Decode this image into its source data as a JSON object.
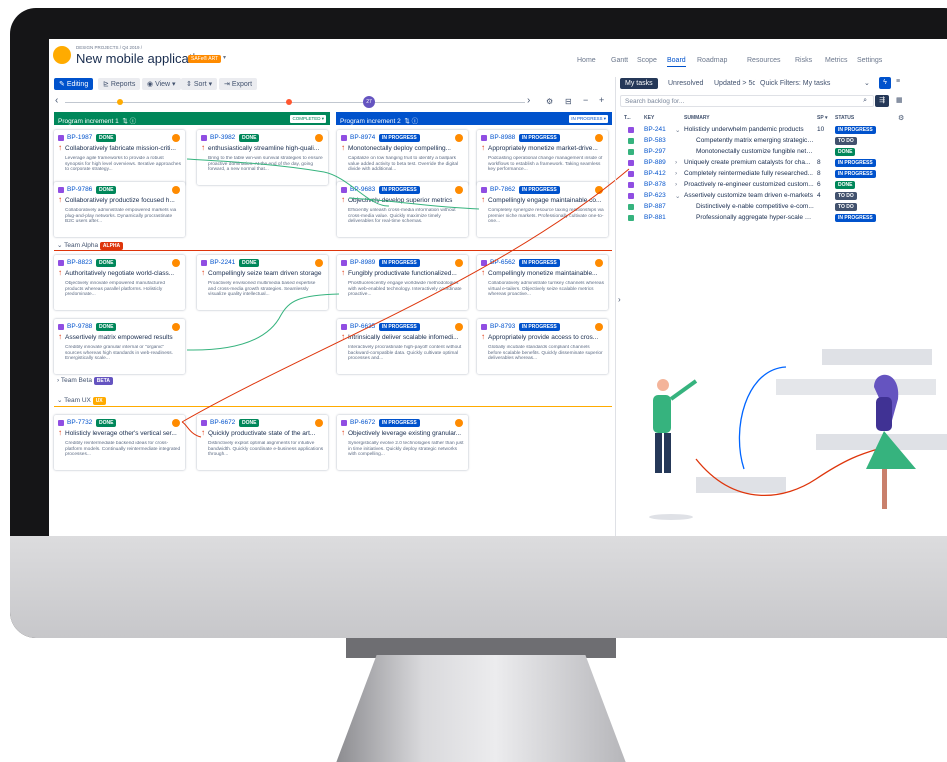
{
  "project": {
    "breadcrumb": "DESIGN PROJECTS / Q4 2019 /",
    "title": "New mobile application",
    "badge": "SAFe® ART"
  },
  "nav": [
    "Home",
    "Gantt",
    "Scope",
    "Board",
    "Roadmap",
    "Resources",
    "Risks",
    "Metrics",
    "Settings"
  ],
  "toolbar": {
    "editing": "Editing",
    "reports": "Reports",
    "view": "View",
    "sort": "Sort",
    "export": "Export"
  },
  "timeline": {
    "marker": "27"
  },
  "pi1": {
    "label": "Program increment 1",
    "badge": "COMPLETED"
  },
  "pi2": {
    "label": "Program increment 2",
    "badge": "IN PROGRESS"
  },
  "lanes": {
    "alpha": "Team Alpha",
    "alpha_tag": "ALPHA",
    "beta": "Team Beta",
    "beta_tag": "BETA",
    "ux": "Team UX",
    "ux_tag": "UX"
  },
  "cards": [
    {
      "key": "BP-1987",
      "status": "DONE",
      "title": "Collaboratively fabricate mission-criti...",
      "desc": "Leverage agile frameworks to provide a robust synopsis for high level overviews. Iterative approaches to corporate strategy..."
    },
    {
      "key": "BP-3982",
      "status": "DONE",
      "title": "enthusiastically streamline high-quali...",
      "desc": "Bring to the table win-win survival strategies to ensure proactive domination. At the end of the day, going forward, a new normal that..."
    },
    {
      "key": "BP-8974",
      "status": "IN PROGRESS",
      "title": "Monotonectally deploy compelling...",
      "desc": "Capitalize on low hanging fruit to identify a ballpark value added activity to beta test. Override the digital divide with additional..."
    },
    {
      "key": "BP-8988",
      "status": "IN PROGRESS",
      "title": "Appropriately monetize market-drive...",
      "desc": "Podcasting operational change management inside of workflows to establish a framework. Taking seamless key performance..."
    },
    {
      "key": "BP-9786",
      "status": "DONE",
      "title": "Collaboratively productize focused h...",
      "desc": "Collaboratively administrate empowered markets via plug-and-play networks. Dynamically procrastinate B2C users after..."
    },
    {
      "key": "BP-9683",
      "status": "IN PROGRESS",
      "title": "Objectively develop superior metrics",
      "desc": "Efficiently unleash cross-media information without cross-media value. Quickly maximize timely deliverables for real-time schemas."
    },
    {
      "key": "BP-7862",
      "status": "IN PROGRESS",
      "title": "Compellingly engage maintainable co...",
      "desc": "Completely synergize resource taxing relationships via premier niche markets. Professionally cultivate one-to-one..."
    },
    {
      "key": "BP-8823",
      "status": "DONE",
      "title": "Authoritatively negotiate world-class...",
      "desc": "Objectively innovate empowered manufactured products whereas parallel platforms. Holisticly predominate..."
    },
    {
      "key": "BP-2241",
      "status": "DONE",
      "title": "Compellingly seize team driven storage",
      "desc": "Proactively envisioned multimedia based expertise and cross-media growth strategies. Seamlessly visualize quality intellectual..."
    },
    {
      "key": "BP-8989",
      "status": "IN PROGRESS",
      "title": "Fungibly productivate functionalized...",
      "desc": "Phosfluorescently engage worldwide methodologies with web-enabled technology. Interactively coordinate proactive..."
    },
    {
      "key": "BP-6562",
      "status": "IN PROGRESS",
      "title": "Compellingly monetize maintainable...",
      "desc": "Collaboratively administrate turnkey channels whereas virtual e-tailers. Objectively seize scalable metrics whereas proactive..."
    },
    {
      "key": "BP-9788",
      "status": "DONE",
      "title": "Assertively matrix empowered results",
      "desc": "Credibly innovate granular internal or \"organic\" sources whereas high standards in web-readiness. Energistically scale..."
    },
    {
      "key": "BP-6635",
      "status": "IN PROGRESS",
      "title": "Intrinsically deliver scalable infomedi...",
      "desc": "Interactively procrastinate high-payoff content without backward-compatible data. Quickly cultivate optimal processes and..."
    },
    {
      "key": "BP-8793",
      "status": "IN PROGRESS",
      "title": "Appropriately provide access to cros...",
      "desc": "Globally incubate standards compliant channels before scalable benefits. Quickly disseminate superior deliverables whereas..."
    },
    {
      "key": "BP-7732",
      "status": "DONE",
      "title": "Holisticly leverage other's vertical ser...",
      "desc": "Credibly reintermediate backend ideas for cross-platform models. Continually reintermediate integrated processes..."
    },
    {
      "key": "BP-6672",
      "status": "DONE",
      "title": "Quickly productivate state of the art...",
      "desc": "Distinctively exploit optimal alignments for intuitive bandwidth. Quickly coordinate e-business applications through..."
    },
    {
      "key": "BP-6672",
      "status": "IN PROGRESS",
      "title": "Objectively leverage existing granular...",
      "desc": "Synergistically evolve 2.0 technologies rather than just in time initiatives. Quickly deploy strategic networks with compelling..."
    }
  ],
  "panel": {
    "tabs": [
      "My tasks",
      "Unresolved",
      "Updated > 5d",
      "Quick Filters: My tasks"
    ],
    "search_placeholder": "Search backlog for...",
    "headers": {
      "t": "T...",
      "key": "KEY",
      "summary": "SUMMARY",
      "sp": "SP",
      "status": "STATUS"
    },
    "rows": [
      {
        "key": "BP-241",
        "summary": "Holisticly underwhelm pandemic products",
        "sp": "10",
        "status": "IN PROGRESS",
        "type": "epic"
      },
      {
        "key": "BP-583",
        "summary": "Competently matrix emerging strategic th...",
        "sp": "",
        "status": "TO DO",
        "type": "story"
      },
      {
        "key": "BP-297",
        "summary": "Monotonectally customize fungible netwo...",
        "sp": "",
        "status": "DONE",
        "type": "story"
      },
      {
        "key": "BP-889",
        "summary": "Uniquely create premium catalysts for cha...",
        "sp": "8",
        "status": "IN PROGRESS",
        "type": "epic"
      },
      {
        "key": "BP-412",
        "summary": "Completely reintermediate fully researched...",
        "sp": "8",
        "status": "IN PROGRESS",
        "type": "epic"
      },
      {
        "key": "BP-878",
        "summary": "Proactively re-engineer customized custom...",
        "sp": "6",
        "status": "DONE",
        "type": "epic"
      },
      {
        "key": "BP-623",
        "summary": "Assertively customize team driven e-markets",
        "sp": "4",
        "status": "TO DO",
        "type": "epic"
      },
      {
        "key": "BP-887",
        "summary": "Distinctively e-nable competitive e-com...",
        "sp": "",
        "status": "TO DO",
        "type": "story"
      },
      {
        "key": "BP-881",
        "summary": "Professionally aggregate hyper-scale met...",
        "sp": "",
        "status": "IN PROGRESS",
        "type": "story"
      }
    ]
  },
  "colors": {
    "pi1": "#00875a",
    "pi2": "#0052cc",
    "accent": "#0052cc",
    "red": "#de350b",
    "green": "#36b37e"
  }
}
